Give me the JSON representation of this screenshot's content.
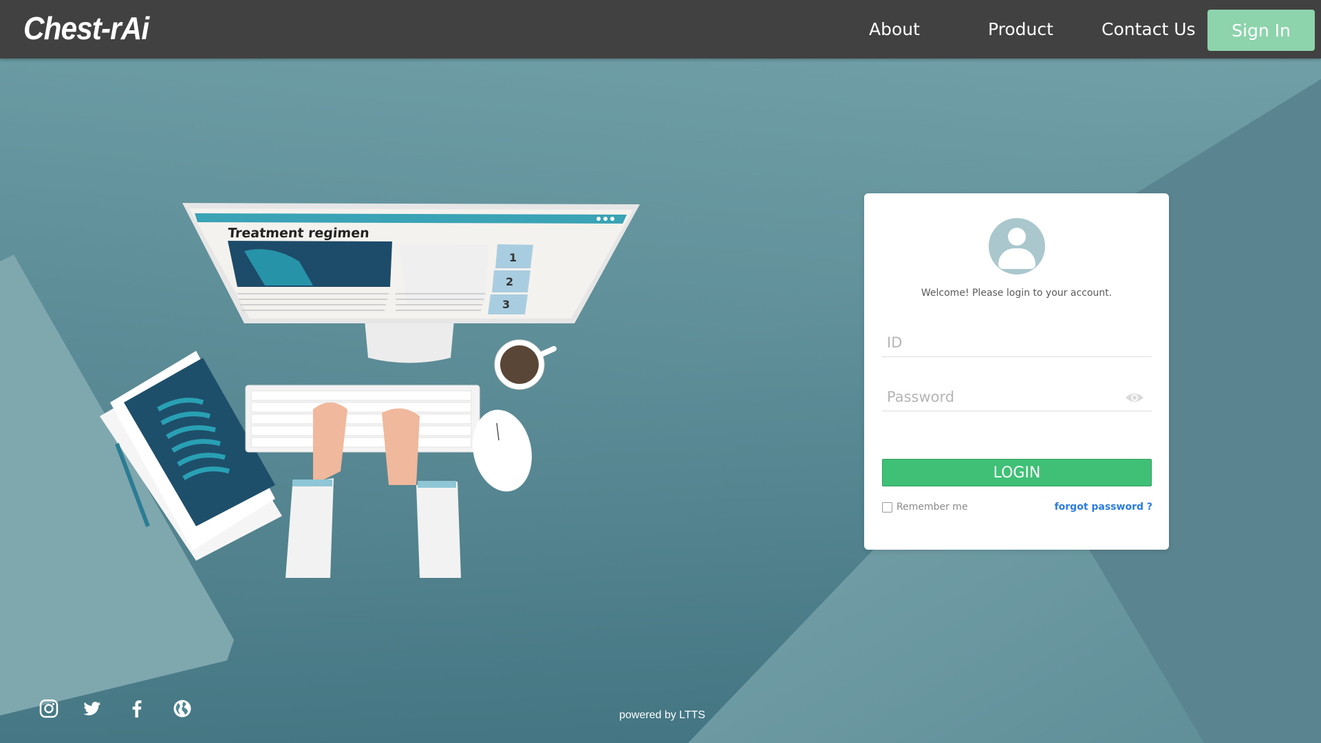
{
  "nav": {
    "logo": "Chest-rAi",
    "links": [
      "About",
      "Product",
      "Contact Us"
    ],
    "signin_label": "Sign In"
  },
  "illustration": {
    "monitor_title": "Treatment regimen",
    "steps": [
      "1",
      "2",
      "3"
    ]
  },
  "login": {
    "welcome": "Welcome! Please login to your account.",
    "id_placeholder": "ID",
    "password_placeholder": "Password",
    "login_label": "LOGIN",
    "remember_label": "Remember me",
    "forgot_label": "forgot password ?"
  },
  "footer": {
    "powered_by": "powered by LTTS",
    "social_icons": [
      "instagram-icon",
      "twitter-icon",
      "facebook-icon",
      "globe-icon"
    ]
  },
  "colors": {
    "navbar": "#414141",
    "signin": "#8dd3ac",
    "login_button": "#3fc076",
    "link": "#2a7be4",
    "background": "#4f8592"
  }
}
